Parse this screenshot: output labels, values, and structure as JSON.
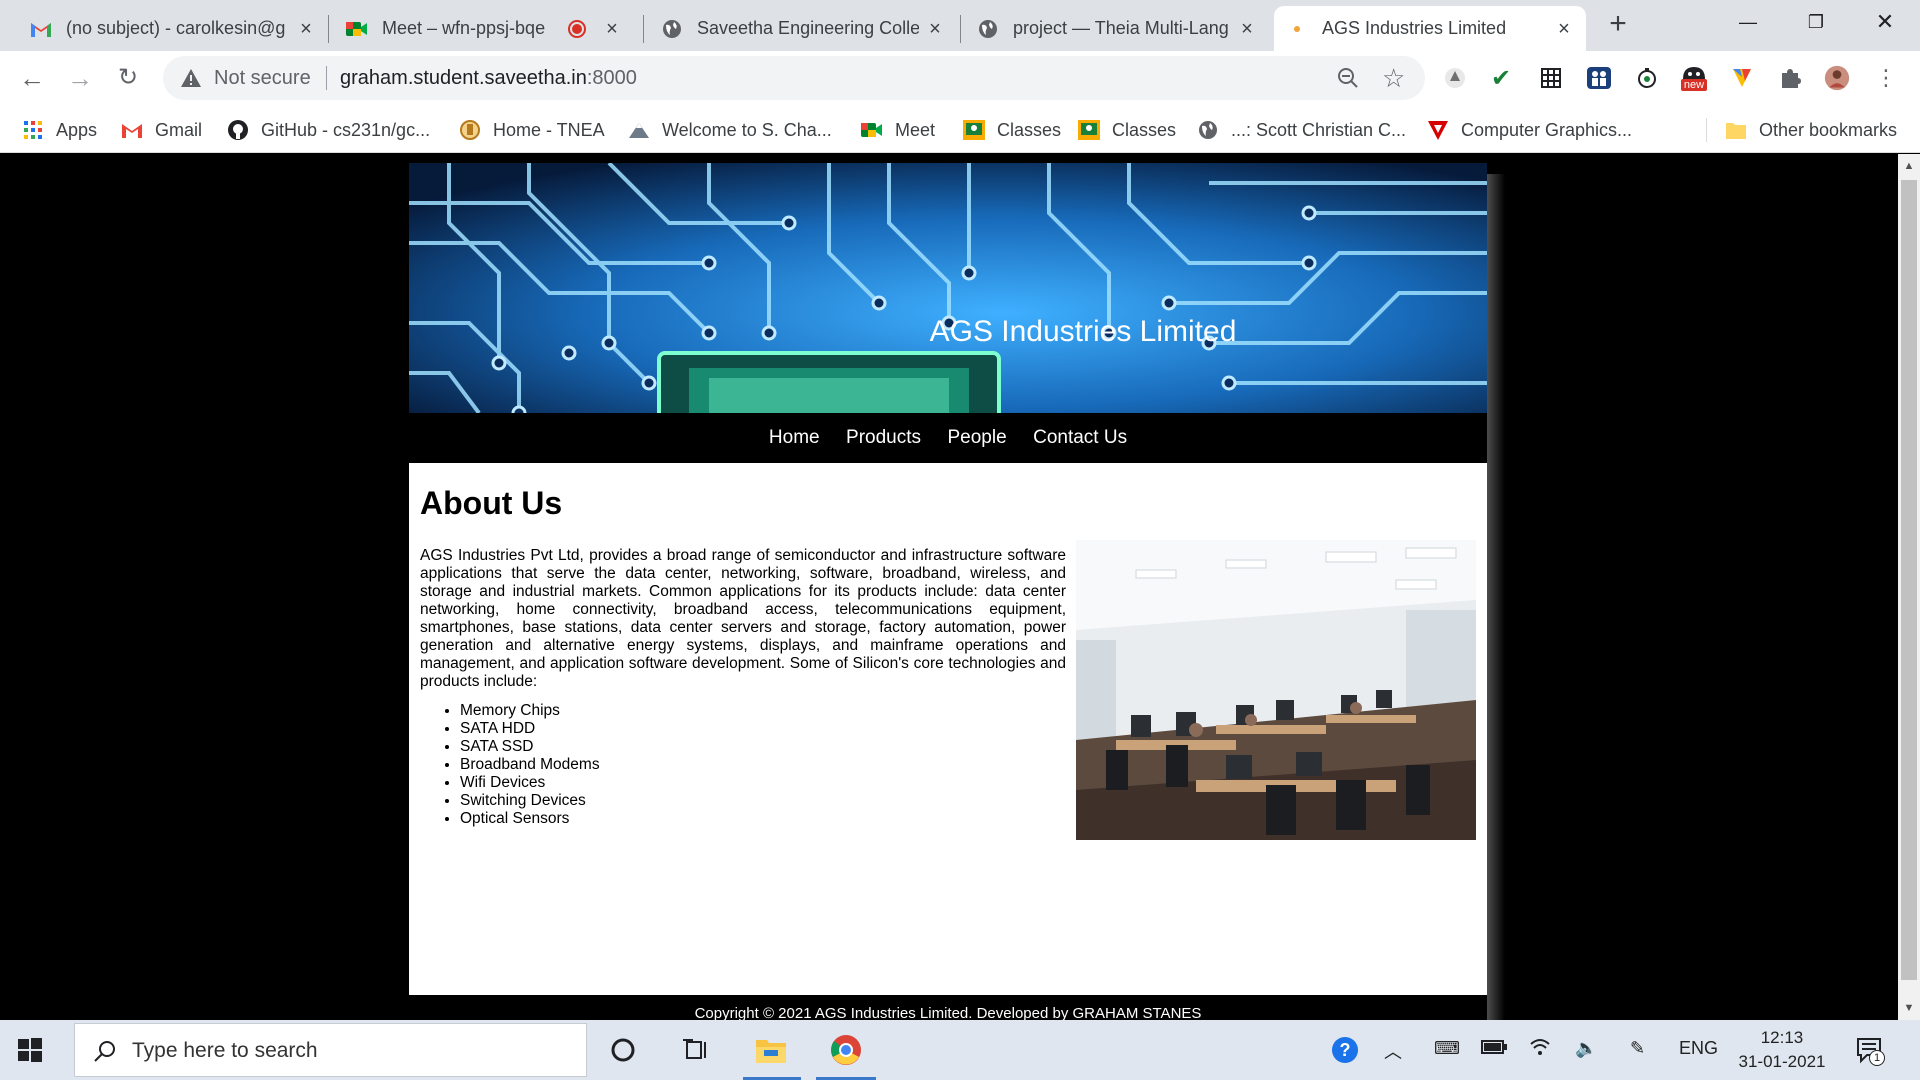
{
  "browser": {
    "tabs": [
      {
        "label": "(no subject) - carolkesin@g",
        "icon": "gmail-icon",
        "active": false
      },
      {
        "label": "Meet – wfn-ppsj-bqe",
        "icon": "google-meet-icon",
        "active": false
      },
      {
        "label": "Saveetha Engineering Colle",
        "icon": "globe-icon",
        "active": false
      },
      {
        "label": "project — Theia Multi-Lang",
        "icon": "globe-icon",
        "active": false
      },
      {
        "label": "AGS Industries Limited",
        "icon": "page-favicon-icon",
        "active": true
      }
    ],
    "address": {
      "security_label": "Not secure",
      "host": "graham.student.saveetha.in",
      "port": ":8000"
    },
    "bookmarks": [
      {
        "label": "Apps",
        "icon": "apps-grid-icon"
      },
      {
        "label": "Gmail",
        "icon": "gmail-icon"
      },
      {
        "label": "GitHub - cs231n/gc...",
        "icon": "github-icon"
      },
      {
        "label": "Home - TNEA",
        "icon": "tnea-emblem-icon"
      },
      {
        "label": "Welcome to S. Cha...",
        "icon": "mountain-logo-icon"
      },
      {
        "label": "Meet",
        "icon": "google-meet-icon"
      },
      {
        "label": "Classes",
        "icon": "google-classroom-icon"
      },
      {
        "label": "Classes",
        "icon": "google-classroom-icon"
      },
      {
        "label": "...: Scott Christian C...",
        "icon": "globe-icon"
      },
      {
        "label": "Computer Graphics...",
        "icon": "red-v-logo-icon"
      }
    ],
    "other_bookmarks": "Other bookmarks",
    "extension_badge": "new"
  },
  "site": {
    "banner_title": "AGS Industries Limited",
    "nav": [
      "Home",
      "Products",
      "People",
      "Contact Us"
    ],
    "heading": "About Us",
    "about_text": "AGS Industries Pvt Ltd, provides a broad range of semiconductor and infrastructure software applications that serve the data center, networking, software, broadband, wireless, and storage and industrial markets. Common applications for its products include: data center networking, home connectivity, broadband access, telecommunications equipment, smartphones, base stations, data center servers and storage, factory automation, power generation and alternative energy systems, displays, and mainframe operations and management, and application software development. Some of Silicon's core technologies and products include:",
    "core_products": [
      "Memory Chips",
      "SATA HDD",
      "SATA SSD",
      "Broadband Modems",
      "Wifi Devices",
      "Switching Devices",
      "Optical Sensors"
    ],
    "footer": "Copyright © 2021 AGS Industries Limited. Developed by GRAHAM STANES"
  },
  "taskbar": {
    "search_placeholder": "Type here to search",
    "language": "ENG",
    "time": "12:13",
    "date": "31-01-2021",
    "notification_count": "1"
  },
  "colors": {
    "tabstrip": "#dee1e6",
    "banner_blue": "#1e7fd1",
    "taskbar": "#dfe6ef"
  }
}
